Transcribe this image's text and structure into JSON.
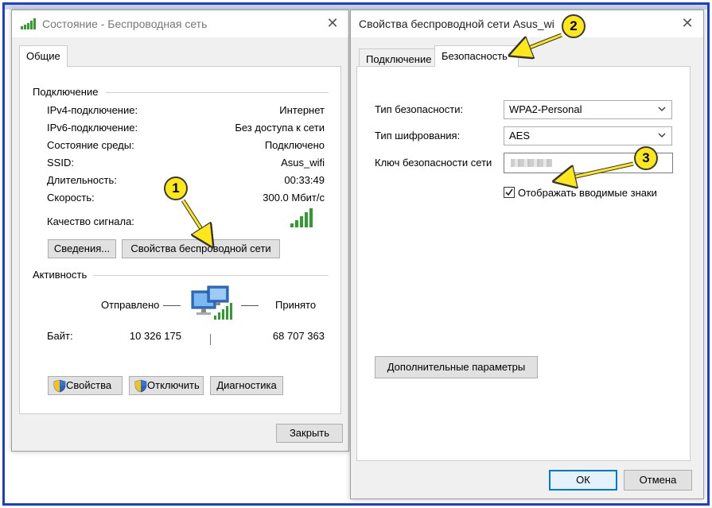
{
  "status_window": {
    "title": "Состояние - Беспроводная сеть",
    "tab_general": "Общие",
    "connection": {
      "heading": "Подключение",
      "rows": [
        {
          "label": "IPv4-подключение:",
          "value": "Интернет"
        },
        {
          "label": "IPv6-подключение:",
          "value": "Без доступа к сети"
        },
        {
          "label": "Состояние среды:",
          "value": "Подключено"
        },
        {
          "label": "SSID:",
          "value": "Asus_wifi"
        },
        {
          "label": "Длительность:",
          "value": "00:33:49"
        },
        {
          "label": "Скорость:",
          "value": "300.0 Мбит/с"
        }
      ],
      "signal_label": "Качество сигнала:",
      "details_button": "Сведения...",
      "wireless_props_button": "Свойства беспроводной сети"
    },
    "activity": {
      "heading": "Активность",
      "sent_label": "Отправлено",
      "received_label": "Принято",
      "bytes_label": "Байт:",
      "bytes_sent": "10 326 175",
      "bytes_received": "68 707 363"
    },
    "buttons": {
      "properties": "Свойства",
      "disable": "Отключить",
      "diagnose": "Диагностика",
      "close": "Закрыть"
    }
  },
  "props_window": {
    "title": "Свойства беспроводной сети Asus_wi",
    "tab_connection": "Подключение",
    "tab_security": "Безопасность",
    "security_type_label": "Тип безопасности:",
    "security_type_value": "WPA2-Personal",
    "encryption_type_label": "Тип шифрования:",
    "encryption_type_value": "AES",
    "network_key_label": "Ключ безопасности сети",
    "show_chars_label": "Отображать вводимые знаки",
    "show_chars_checked": true,
    "advanced_button": "Дополнительные параметры",
    "ok_button": "ОК",
    "cancel_button": "Отмена"
  },
  "callouts": {
    "one": "1",
    "two": "2",
    "three": "3"
  },
  "colors": {
    "callout_fill": "#ffe81a",
    "signal_green": "#2f9e2f",
    "frame_blue": "#1b3fd0",
    "focus_blue": "#0078d7"
  },
  "icons": {
    "wifi": "wifi-signal-icon",
    "shield": "uac-shield-icon",
    "network": "network-computers-icon",
    "close": "close-icon",
    "chevron": "chevron-down-icon",
    "check": "checkmark-icon"
  }
}
